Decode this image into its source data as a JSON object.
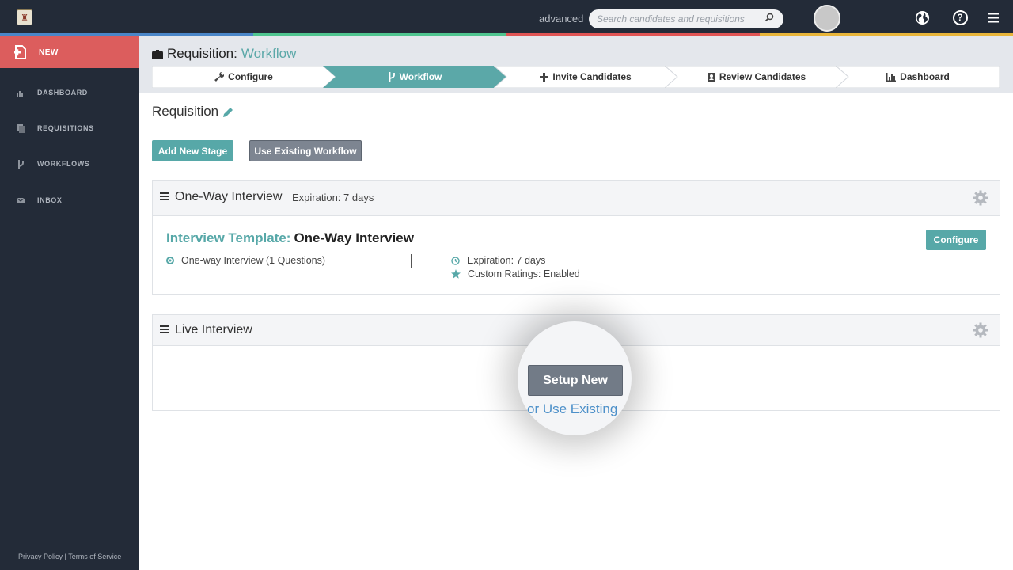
{
  "topbar": {
    "advanced_label": "advanced",
    "search_placeholder": "Search candidates and requisitions",
    "stripe_colors": [
      "#4a86c8",
      "#4fc58f",
      "#e05454",
      "#e8b53a"
    ]
  },
  "sidebar": {
    "new_label": "NEW",
    "items": [
      {
        "label": "DASHBOARD",
        "icon": "bar-chart-icon"
      },
      {
        "label": "REQUISITIONS",
        "icon": "document-icon"
      },
      {
        "label": "WORKFLOWS",
        "icon": "branch-icon"
      },
      {
        "label": "INBOX",
        "icon": "envelope-icon"
      }
    ],
    "footer": "Privacy Policy | Terms of Service"
  },
  "header": {
    "title_prefix": "Requisition:",
    "title_accent": "Workflow"
  },
  "steps": [
    {
      "label": "Configure",
      "icon": "wrench-icon",
      "active": false
    },
    {
      "label": "Workflow",
      "icon": "branch-icon",
      "active": true
    },
    {
      "label": "Invite Candidates",
      "icon": "plus-icon",
      "active": false
    },
    {
      "label": "Review Candidates",
      "icon": "contact-icon",
      "active": false
    },
    {
      "label": "Dashboard",
      "icon": "bar-chart-icon",
      "active": false
    }
  ],
  "content": {
    "requisition_title": "Requisition",
    "add_stage_label": "Add New Stage",
    "use_existing_workflow_label": "Use Existing Workflow"
  },
  "stage1": {
    "title": "One-Way Interview",
    "expiration": "Expiration: 7 days",
    "template_key": "Interview Template:",
    "template_value": "One-Way Interview",
    "configure_label": "Configure",
    "questions": "One-way Interview (1 Questions)",
    "detail_expiration": "Expiration: 7 days",
    "ratings": "Custom Ratings: Enabled"
  },
  "stage2": {
    "title": "Live Interview",
    "setup_new_label": "Setup New",
    "use_existing_label": "or Use Existing"
  },
  "colors": {
    "accent": "#57a8a8",
    "new_button": "#dc5d5d",
    "sidebar_bg": "#232b38",
    "link": "#4d90c9"
  }
}
